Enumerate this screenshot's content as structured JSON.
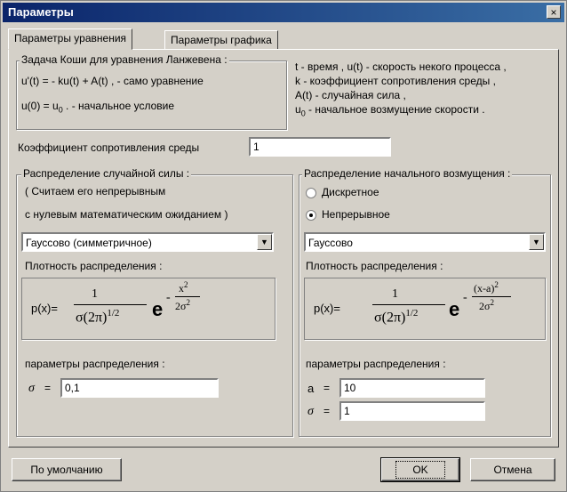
{
  "window": {
    "title": "Параметры",
    "close_glyph": "×"
  },
  "tabs": [
    {
      "label": "Параметры уравнения"
    },
    {
      "label": "Параметры графика"
    }
  ],
  "info": {
    "task_title": "Задача Коши для уравнения Ланжевена :",
    "equation": "u'(t) = - ku(t) + A(t) , - само уравнение",
    "initial_left": "u(0) = u",
    "initial_sub": "0",
    "initial_right": " . - начальное условие",
    "legend1": "t - время , u(t) - скорость некого процесса ,",
    "legend2": "k - коэффициент сопротивления среды ,",
    "legend3": "A(t) - случайная сила ,",
    "legend4_pre": "u",
    "legend4_sub": "0",
    "legend4_post": " - начальное возмущение скорости ."
  },
  "resistance": {
    "label": "Коэффициент сопротивления среды",
    "value": "1"
  },
  "left_group": {
    "title": "Распределение случайной силы :",
    "note1": "( Считаем его непрерывным",
    "note2": "с нулевым математическим ожиданием )",
    "select_value": "Гауссово (симметричное)",
    "density_label": "Плотность распределения :",
    "formula": {
      "lhs": "p(x)=",
      "num": "1",
      "den": "σ(2π)",
      "den_exp": "1/2",
      "e": "e",
      "sign": "-",
      "exp_num": "x",
      "exp_num_sup": "2",
      "exp_den": "2σ",
      "exp_den_sup": "2"
    },
    "params_label": "параметры распределения :",
    "sigma_symbol": "σ",
    "eq": "=",
    "sigma_value": "0,1"
  },
  "right_group": {
    "title": "Распределение начального возмущения :",
    "radio_discrete": "Дискретное",
    "radio_continuous": "Непрерывное",
    "select_value": "Гауссово",
    "density_label": "Плотность распределения :",
    "formula": {
      "lhs": "p(x)=",
      "num": "1",
      "den": "σ(2π)",
      "den_exp": "1/2",
      "e": "e",
      "sign": "-",
      "exp_num": "(x-a)",
      "exp_num_sup": "2",
      "exp_den": "2σ",
      "exp_den_sup": "2"
    },
    "params_label": "параметры распределения :",
    "a_symbol": "a",
    "sigma_symbol": "σ",
    "eq": "=",
    "a_value": "10",
    "sigma_value": "1"
  },
  "buttons": {
    "defaults": "По умолчанию",
    "ok": "OK",
    "cancel": "Отмена"
  }
}
